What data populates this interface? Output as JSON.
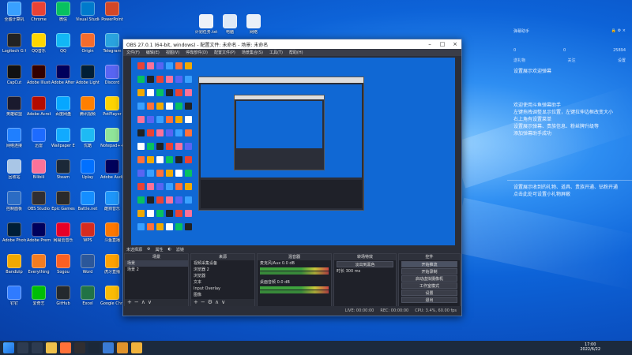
{
  "desktop": {
    "icons": [
      {
        "label": "全盛计算机",
        "color": "#39a0ff"
      },
      {
        "label": "Logitech G HUB",
        "color": "#222"
      },
      {
        "label": "CapCut",
        "color": "#111"
      },
      {
        "label": "英雄联盟",
        "color": "#1a1a2e"
      },
      {
        "label": "网络连接",
        "color": "#1f7fff"
      },
      {
        "label": "回收站",
        "color": "#a9c6e6"
      },
      {
        "label": "控制面板",
        "color": "#2b6cc4"
      },
      {
        "label": "Adobe Photoshop",
        "color": "#001e36"
      },
      {
        "label": "Bandizip",
        "color": "#f2a900"
      },
      {
        "label": "钉钉",
        "color": "#2f7bff"
      },
      {
        "label": "Chrome",
        "color": "#e94235"
      },
      {
        "label": "QQ音乐",
        "color": "#ffd600"
      },
      {
        "label": "Adobe Illustrator",
        "color": "#330000"
      },
      {
        "label": "Adobe Acrobat",
        "color": "#b30b00"
      },
      {
        "label": "迅雷",
        "color": "#1d6bff"
      },
      {
        "label": "Bilibili",
        "color": "#fb7299"
      },
      {
        "label": "OBS Studio",
        "color": "#302e31"
      },
      {
        "label": "Adobe Premiere",
        "color": "#00005b"
      },
      {
        "label": "Everything",
        "color": "#f47c20"
      },
      {
        "label": "爱奇艺",
        "color": "#00be06"
      },
      {
        "label": "微信",
        "color": "#07c160"
      },
      {
        "label": "QQ",
        "color": "#12b7f5"
      },
      {
        "label": "Adobe After Effects",
        "color": "#00005b"
      },
      {
        "label": "百度网盘",
        "color": "#06a7ff"
      },
      {
        "label": "Wallpaper Engine",
        "color": "#11aaff"
      },
      {
        "label": "Steam",
        "color": "#1b2838"
      },
      {
        "label": "Epic Games",
        "color": "#2a2a2a"
      },
      {
        "label": "网易云音乐",
        "color": "#e60026"
      },
      {
        "label": "Sogou",
        "color": "#fb6022"
      },
      {
        "label": "GitHub",
        "color": "#24292e"
      },
      {
        "label": "Visual Studio Code",
        "color": "#007acc"
      },
      {
        "label": "Origin",
        "color": "#f56c2d"
      },
      {
        "label": "Adobe Lightroom",
        "color": "#001e36"
      },
      {
        "label": "腾讯视频",
        "color": "#ff7f00"
      },
      {
        "label": "优酷",
        "color": "#1ebaf4"
      },
      {
        "label": "Uplay",
        "color": "#0070ff"
      },
      {
        "label": "Battle.net",
        "color": "#148eff"
      },
      {
        "label": "WPS",
        "color": "#d52b1e"
      },
      {
        "label": "Word",
        "color": "#2b579a"
      },
      {
        "label": "Excel",
        "color": "#217346"
      },
      {
        "label": "PowerPoint",
        "color": "#d24726"
      },
      {
        "label": "Telegram",
        "color": "#2aa3df"
      },
      {
        "label": "Discord",
        "color": "#5865f2"
      },
      {
        "label": "PotPlayer",
        "color": "#ffd400"
      },
      {
        "label": "Notepad++",
        "color": "#90e59a"
      },
      {
        "label": "Adobe Audition",
        "color": "#00005b"
      },
      {
        "label": "酷狗音乐",
        "color": "#1e96fa"
      },
      {
        "label": "斗鱼直播",
        "color": "#ff7800"
      },
      {
        "label": "虎牙直播",
        "color": "#ffa200"
      },
      {
        "label": "Google Chrome",
        "color": "#fbbc05"
      }
    ],
    "top_icons": [
      {
        "label": "计划任务.txt",
        "color": "#eef2f8"
      },
      {
        "label": "电脑",
        "color": "#dde8f6"
      },
      {
        "label": "网络",
        "color": "#eaf0f8"
      }
    ]
  },
  "chat": {
    "title": "弹幕助手",
    "stats": {
      "viewers": "0",
      "likes": "0",
      "hot": "25894"
    },
    "tabs": [
      "送礼物",
      "关注",
      "设置"
    ],
    "messages": [
      "欢迎使用斗鱼弹幕助手",
      "左键拖拽调整显示位置，左键拉伸边框改变大小",
      "右上角有设置菜单",
      "设置展示弹幕、贵族信息、粉丝牌升级等",
      "添加弹幕助手成功"
    ],
    "notes": [
      "设置展示收到的礼物、道具、贵族开通、钻粉开通",
      "点击此处可设置小礼物屏蔽"
    ],
    "header_note": "设置展示欢迎弹幕"
  },
  "obs": {
    "title": "OBS 27.0.1 (64-bit, windows) - 配置文件: 未命名 - 场景: 未命名",
    "menu": [
      "文件(F)",
      "编辑(E)",
      "视图(V)",
      "停靠部件(D)",
      "配置文件(P)",
      "场景集合(S)",
      "工具(T)",
      "帮助(H)"
    ],
    "scene_bar": [
      "未选择源",
      "属性",
      "滤镜"
    ],
    "docks": {
      "scenes": {
        "title": "场景",
        "items": [
          "场景",
          "场景 2"
        ]
      },
      "sources": {
        "title": "来源",
        "items": [
          "视频采集设备",
          "浏览器 2",
          "浏览器",
          "文本",
          "Input Overlay",
          "图像"
        ]
      },
      "mixer": {
        "title": "混音器",
        "tracks": [
          {
            "name": "麦克风/Aux",
            "db": "0.0 dB"
          },
          {
            "name": "桌面音频",
            "db": "0.0 dB"
          }
        ]
      },
      "transitions": {
        "title": "转场特效",
        "transition": "淡出到黑色",
        "duration_label": "时长",
        "duration": "300 ms"
      },
      "controls": {
        "title": "控件",
        "buttons": [
          "开始推流",
          "开始录制",
          "启动虚拟摄像机",
          "工作室模式",
          "设置",
          "退出"
        ]
      }
    },
    "status": [
      "LIVE: 00:00:00",
      "REC: 00:00:00",
      "CPU: 3.4%, 60.00 fps"
    ]
  },
  "taskbar": {
    "time": "17:00",
    "date": "2022/6/22"
  }
}
